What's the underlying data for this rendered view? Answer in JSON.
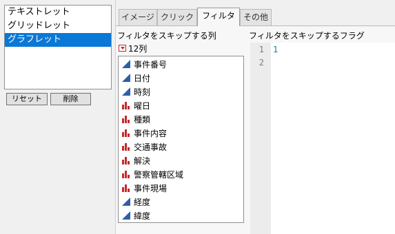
{
  "left_list": {
    "items": [
      {
        "label": "テキストレット",
        "selected": false
      },
      {
        "label": "グリッドレット",
        "selected": false
      },
      {
        "label": "グラフレット",
        "selected": true
      }
    ],
    "reset_label": "リセット",
    "delete_label": "削除"
  },
  "tabs": [
    {
      "label": "イメージ"
    },
    {
      "label": "クリック"
    },
    {
      "label": "フィルタ",
      "active": true
    },
    {
      "label": "その他"
    }
  ],
  "filter": {
    "columns_header": "フィルタをスキップする列",
    "flag_header": "フィルタをスキップするフラグ",
    "column_count": "12列",
    "columns": [
      {
        "name": "事件番号",
        "icon": "continuous-icon"
      },
      {
        "name": "日付",
        "icon": "continuous-icon"
      },
      {
        "name": "時刻",
        "icon": "continuous-icon"
      },
      {
        "name": "曜日",
        "icon": "nominal-icon"
      },
      {
        "name": "種類",
        "icon": "nominal-icon"
      },
      {
        "name": "事件内容",
        "icon": "nominal-icon"
      },
      {
        "name": "交通事故",
        "icon": "nominal-icon"
      },
      {
        "name": "解決",
        "icon": "nominal-icon"
      },
      {
        "name": "警察管轄区域",
        "icon": "nominal-icon"
      },
      {
        "name": "事件現場",
        "icon": "nominal-icon"
      },
      {
        "name": "経度",
        "icon": "continuous-icon"
      },
      {
        "name": "緯度",
        "icon": "continuous-icon"
      }
    ],
    "editor": {
      "line_numbers": [
        "1",
        "2"
      ],
      "lines": [
        "1",
        ""
      ]
    }
  },
  "colors": {
    "selection": "#0a78d7",
    "continuous_icon": "#2f5ea8",
    "nominal_icon": "#c62828",
    "code_text": "#1a7a9b"
  }
}
